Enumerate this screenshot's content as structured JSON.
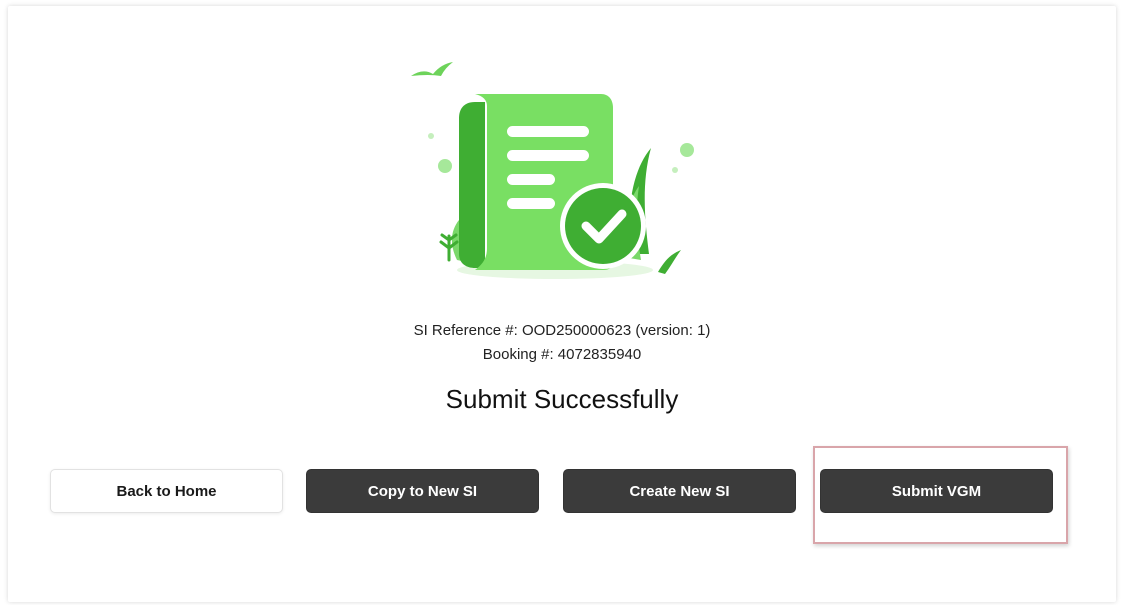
{
  "info": {
    "si_reference": "SI Reference #: OOD250000623 (version: 1)",
    "booking": "Booking #: 4072835940",
    "title": "Submit Successfully"
  },
  "actions": {
    "back_to_home": "Back to Home",
    "copy_to_new_si": "Copy to New SI",
    "create_new_si": "Create New SI",
    "submit_vgm": "Submit VGM"
  },
  "illustration": {
    "icon": "document-check-icon",
    "accent_color": "#5cc94a"
  },
  "colors": {
    "dark_button": "#3b3b3b",
    "highlight_border": "#d9a5aa"
  }
}
